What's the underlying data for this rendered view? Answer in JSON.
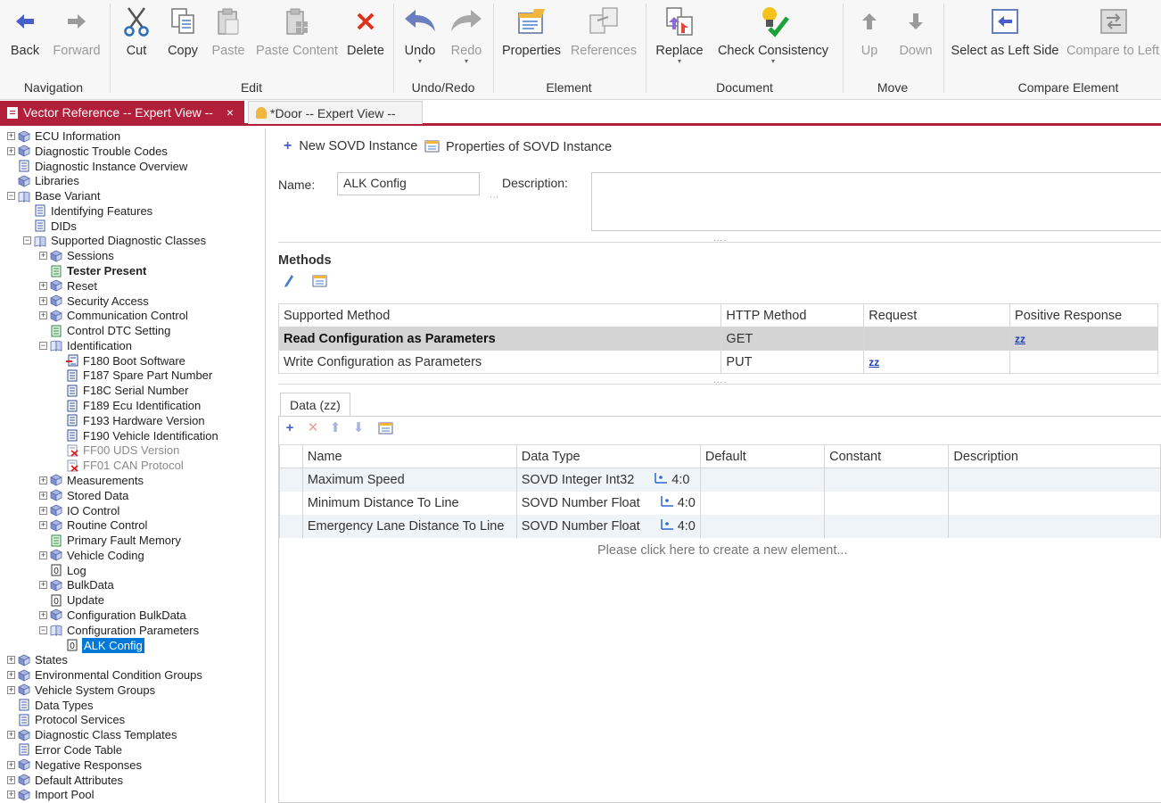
{
  "ribbon": {
    "buttons": {
      "back": "Back",
      "forward": "Forward",
      "cut": "Cut",
      "copy": "Copy",
      "paste": "Paste",
      "paste_content": "Paste Content",
      "delete": "Delete",
      "undo": "Undo",
      "redo": "Redo",
      "properties": "Properties",
      "references": "References",
      "replace": "Replace",
      "check_consistency": "Check Consistency",
      "up": "Up",
      "down": "Down",
      "select_left": "Select as Left Side",
      "compare_left": "Compare to Left S"
    },
    "groups": {
      "navigation": "Navigation",
      "edit": "Edit",
      "undo_redo": "Undo/Redo",
      "element": "Element",
      "document": "Document",
      "move": "Move",
      "compare": "Compare Element"
    }
  },
  "tabs": {
    "active": "Vector Reference -- Expert View --",
    "inactive": "*Door -- Expert View --",
    "close": "×"
  },
  "tree": [
    {
      "label": "ECU Information",
      "level": 0,
      "exp": "+",
      "icon": "book"
    },
    {
      "label": "Diagnostic Trouble Codes",
      "level": 0,
      "exp": "+",
      "icon": "book"
    },
    {
      "label": "Diagnostic Instance Overview",
      "level": 0,
      "exp": "",
      "icon": "page"
    },
    {
      "label": "Libraries",
      "level": 0,
      "exp": "",
      "icon": "book"
    },
    {
      "label": "Base Variant",
      "level": 0,
      "exp": "-",
      "icon": "openbook"
    },
    {
      "label": "Identifying Features",
      "level": 1,
      "exp": "",
      "icon": "page"
    },
    {
      "label": "DIDs",
      "level": 1,
      "exp": "",
      "icon": "page"
    },
    {
      "label": "Supported Diagnostic Classes",
      "level": 1,
      "exp": "-",
      "icon": "openbook"
    },
    {
      "label": "Sessions",
      "level": 2,
      "exp": "+",
      "icon": "book"
    },
    {
      "label": "Tester Present",
      "level": 2,
      "exp": "",
      "icon": "greenpage",
      "bold": true
    },
    {
      "label": "Reset",
      "level": 2,
      "exp": "+",
      "icon": "book"
    },
    {
      "label": "Security Access",
      "level": 2,
      "exp": "+",
      "icon": "book"
    },
    {
      "label": "Communication Control",
      "level": 2,
      "exp": "+",
      "icon": "book"
    },
    {
      "label": "Control DTC Setting",
      "level": 2,
      "exp": "",
      "icon": "greenpage"
    },
    {
      "label": "Identification",
      "level": 2,
      "exp": "-",
      "icon": "openbook"
    },
    {
      "label": "F180 Boot Software",
      "level": 3,
      "exp": "",
      "icon": "redpage"
    },
    {
      "label": "F187 Spare Part Number",
      "level": 3,
      "exp": "",
      "icon": "bluepage"
    },
    {
      "label": "F18C Serial Number",
      "level": 3,
      "exp": "",
      "icon": "bluepage"
    },
    {
      "label": "F189 Ecu Identification",
      "level": 3,
      "exp": "",
      "icon": "bluepage"
    },
    {
      "label": "F193 Hardware Version",
      "level": 3,
      "exp": "",
      "icon": "bluepage"
    },
    {
      "label": "F190 Vehicle Identification",
      "level": 3,
      "exp": "",
      "icon": "bluepage"
    },
    {
      "label": "FF00 UDS Version",
      "level": 3,
      "exp": "",
      "icon": "xpage",
      "disabled": true
    },
    {
      "label": "FF01 CAN Protocol",
      "level": 3,
      "exp": "",
      "icon": "xpage",
      "disabled": true
    },
    {
      "label": "Measurements",
      "level": 2,
      "exp": "+",
      "icon": "book"
    },
    {
      "label": "Stored Data",
      "level": 2,
      "exp": "+",
      "icon": "book"
    },
    {
      "label": "IO Control",
      "level": 2,
      "exp": "+",
      "icon": "book"
    },
    {
      "label": "Routine Control",
      "level": 2,
      "exp": "+",
      "icon": "book"
    },
    {
      "label": "Primary Fault Memory",
      "level": 2,
      "exp": "",
      "icon": "greenpage"
    },
    {
      "label": "Vehicle Coding",
      "level": 2,
      "exp": "+",
      "icon": "book"
    },
    {
      "label": "Log",
      "level": 2,
      "exp": "",
      "icon": "zero"
    },
    {
      "label": "BulkData",
      "level": 2,
      "exp": "+",
      "icon": "book"
    },
    {
      "label": "Update",
      "level": 2,
      "exp": "",
      "icon": "zero"
    },
    {
      "label": "Configuration BulkData",
      "level": 2,
      "exp": "+",
      "icon": "book"
    },
    {
      "label": "Configuration Parameters",
      "level": 2,
      "exp": "-",
      "icon": "openbook"
    },
    {
      "label": "ALK Config",
      "level": 3,
      "exp": "",
      "icon": "zero",
      "selected": true
    },
    {
      "label": "States",
      "level": 0,
      "exp": "+",
      "icon": "book"
    },
    {
      "label": "Environmental Condition Groups",
      "level": 0,
      "exp": "+",
      "icon": "book"
    },
    {
      "label": "Vehicle System Groups",
      "level": 0,
      "exp": "+",
      "icon": "book"
    },
    {
      "label": "Data Types",
      "level": 0,
      "exp": "",
      "icon": "page"
    },
    {
      "label": "Protocol Services",
      "level": 0,
      "exp": "",
      "icon": "page"
    },
    {
      "label": "Diagnostic Class Templates",
      "level": 0,
      "exp": "+",
      "icon": "book"
    },
    {
      "label": "Error Code Table",
      "level": 0,
      "exp": "",
      "icon": "page"
    },
    {
      "label": "Negative Responses",
      "level": 0,
      "exp": "+",
      "icon": "book"
    },
    {
      "label": "Default Attributes",
      "level": 0,
      "exp": "+",
      "icon": "book"
    },
    {
      "label": "Import Pool",
      "level": 0,
      "exp": "+",
      "icon": "book"
    }
  ],
  "main": {
    "new_instance": "New SOVD Instance",
    "properties_instance": "Properties of SOVD Instance",
    "name_label": "Name:",
    "name_value": "ALK Config",
    "description_label": "Description:",
    "description_value": "",
    "grip": "....",
    "methods_title": "Methods",
    "methods_columns": [
      "Supported Method",
      "HTTP Method",
      "Request",
      "Positive Response"
    ],
    "methods_rows": [
      {
        "method": "Read Configuration as Parameters",
        "http": "GET",
        "request": "",
        "response": "zz",
        "selected": true
      },
      {
        "method": "Write Configuration as Parameters",
        "http": "PUT",
        "request": "zz",
        "response": ""
      }
    ],
    "data_tab": "Data (zz)",
    "data_columns": [
      "Name",
      "Data Type",
      "Default",
      "Constant",
      "Description"
    ],
    "data_rows": [
      {
        "name": "Maximum Speed",
        "type": "SOVD Integer Int32",
        "type_value": "4:0"
      },
      {
        "name": "Minimum Distance To Line",
        "type": "SOVD Number Float",
        "type_value": "4:0"
      },
      {
        "name": "Emergency Lane Distance To Line",
        "type": "SOVD Number Float",
        "type_value": "4:0"
      }
    ],
    "new_element_hint": "Please click here to create a new element..."
  }
}
